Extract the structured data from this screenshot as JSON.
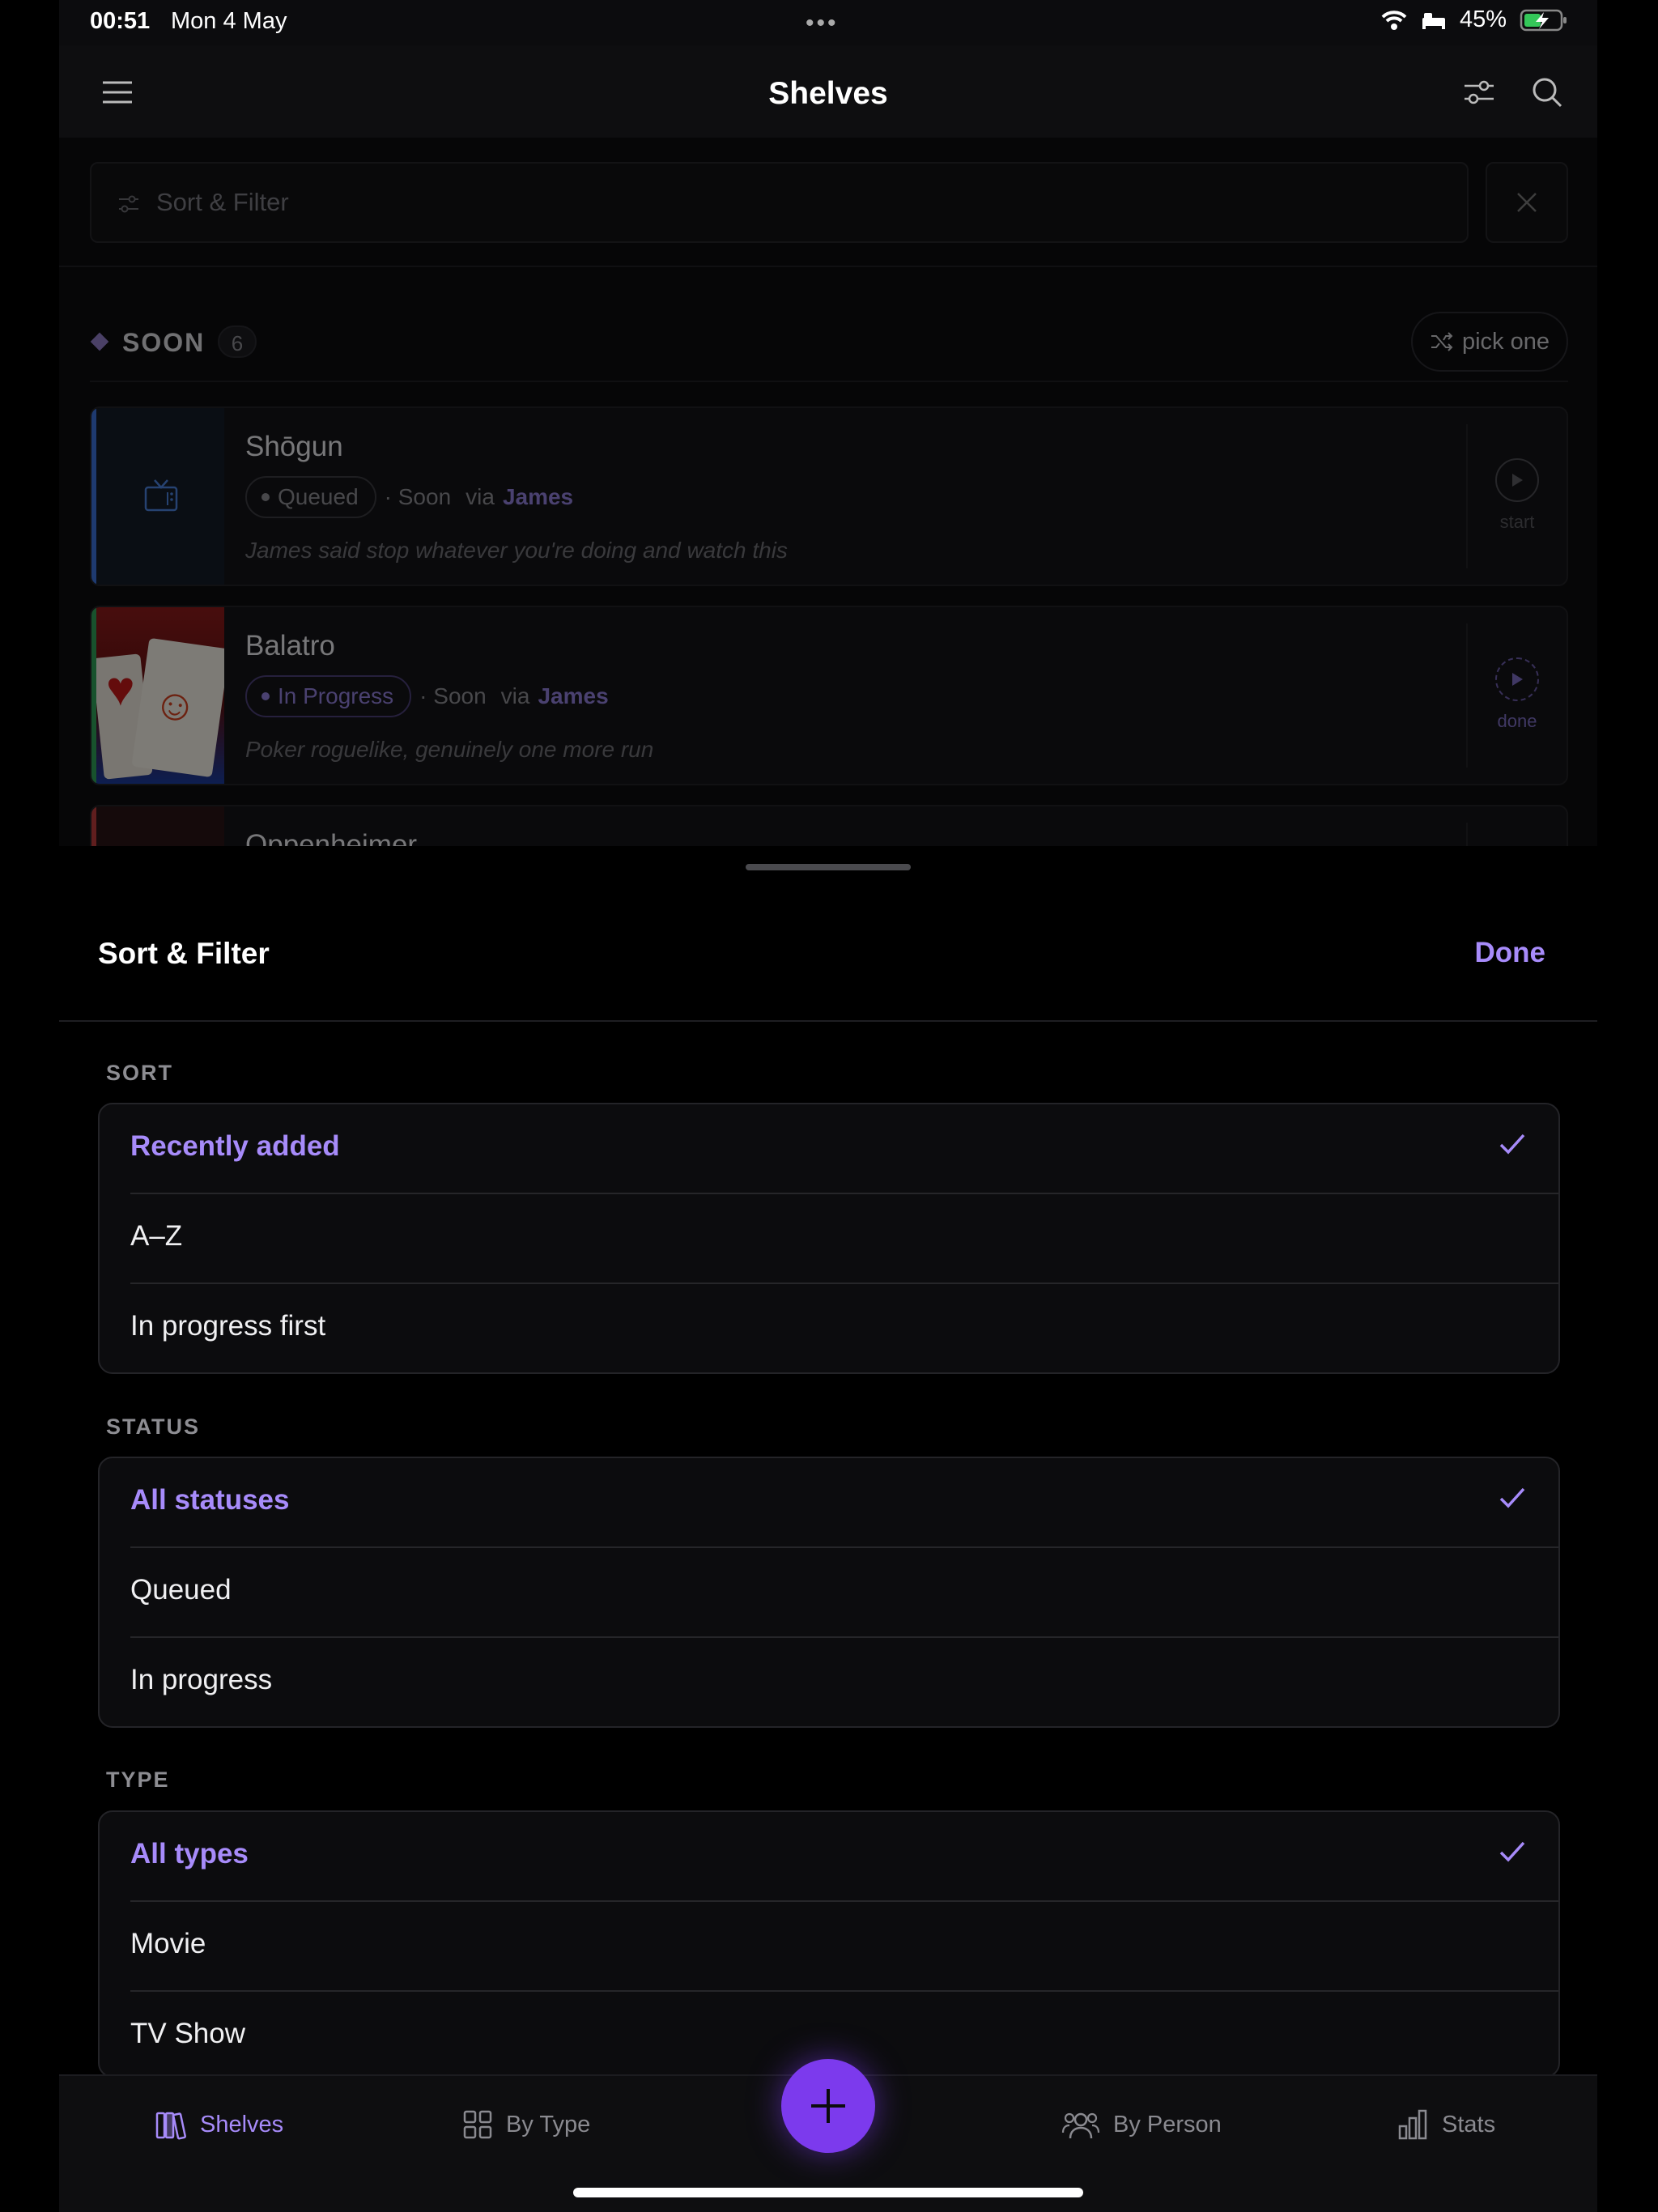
{
  "status_bar": {
    "time": "00:51",
    "date": "Mon 4 May",
    "battery": "45%"
  },
  "nav": {
    "title": "Shelves"
  },
  "filter_bar": {
    "placeholder": "Sort & Filter"
  },
  "section": {
    "title": "SOON",
    "count": "6",
    "pick_label": "pick one"
  },
  "items": [
    {
      "title": "Shōgun",
      "status": "Queued",
      "when": "· Soon",
      "via": "via",
      "person": "James",
      "note": "James said stop whatever you're doing and watch this",
      "action": "start",
      "accent": "#3b6fd6",
      "status_color": "#8a8a90"
    },
    {
      "title": "Balatro",
      "status": "In Progress",
      "when": "· Soon",
      "via": "via",
      "person": "James",
      "note": "Poker roguelike, genuinely one more run",
      "action": "done",
      "accent": "#2f9e57",
      "status_color": "#8f7ed6"
    },
    {
      "title": "Oppenheimer",
      "accent": "#b83a3a"
    }
  ],
  "sheet": {
    "title": "Sort & Filter",
    "done_label": "Done",
    "groups": [
      {
        "label": "SORT",
        "options": [
          "Recently added",
          "A–Z",
          "In progress first"
        ],
        "selected": 0
      },
      {
        "label": "STATUS",
        "options": [
          "All statuses",
          "Queued",
          "In progress"
        ],
        "selected": 0
      },
      {
        "label": "TYPE",
        "options": [
          "All types",
          "Movie",
          "TV Show"
        ],
        "selected": 0
      }
    ]
  },
  "tabs": [
    {
      "label": "Shelves",
      "icon": "books-icon",
      "active": true
    },
    {
      "label": "By Type",
      "icon": "grid-icon",
      "active": false
    },
    {
      "label": "By Person",
      "icon": "people-icon",
      "active": false
    },
    {
      "label": "Stats",
      "icon": "bar-chart-icon",
      "active": false
    }
  ],
  "colors": {
    "accent": "#a78bfa",
    "fab": "#7c3aed",
    "background": "#0c0c0e"
  }
}
